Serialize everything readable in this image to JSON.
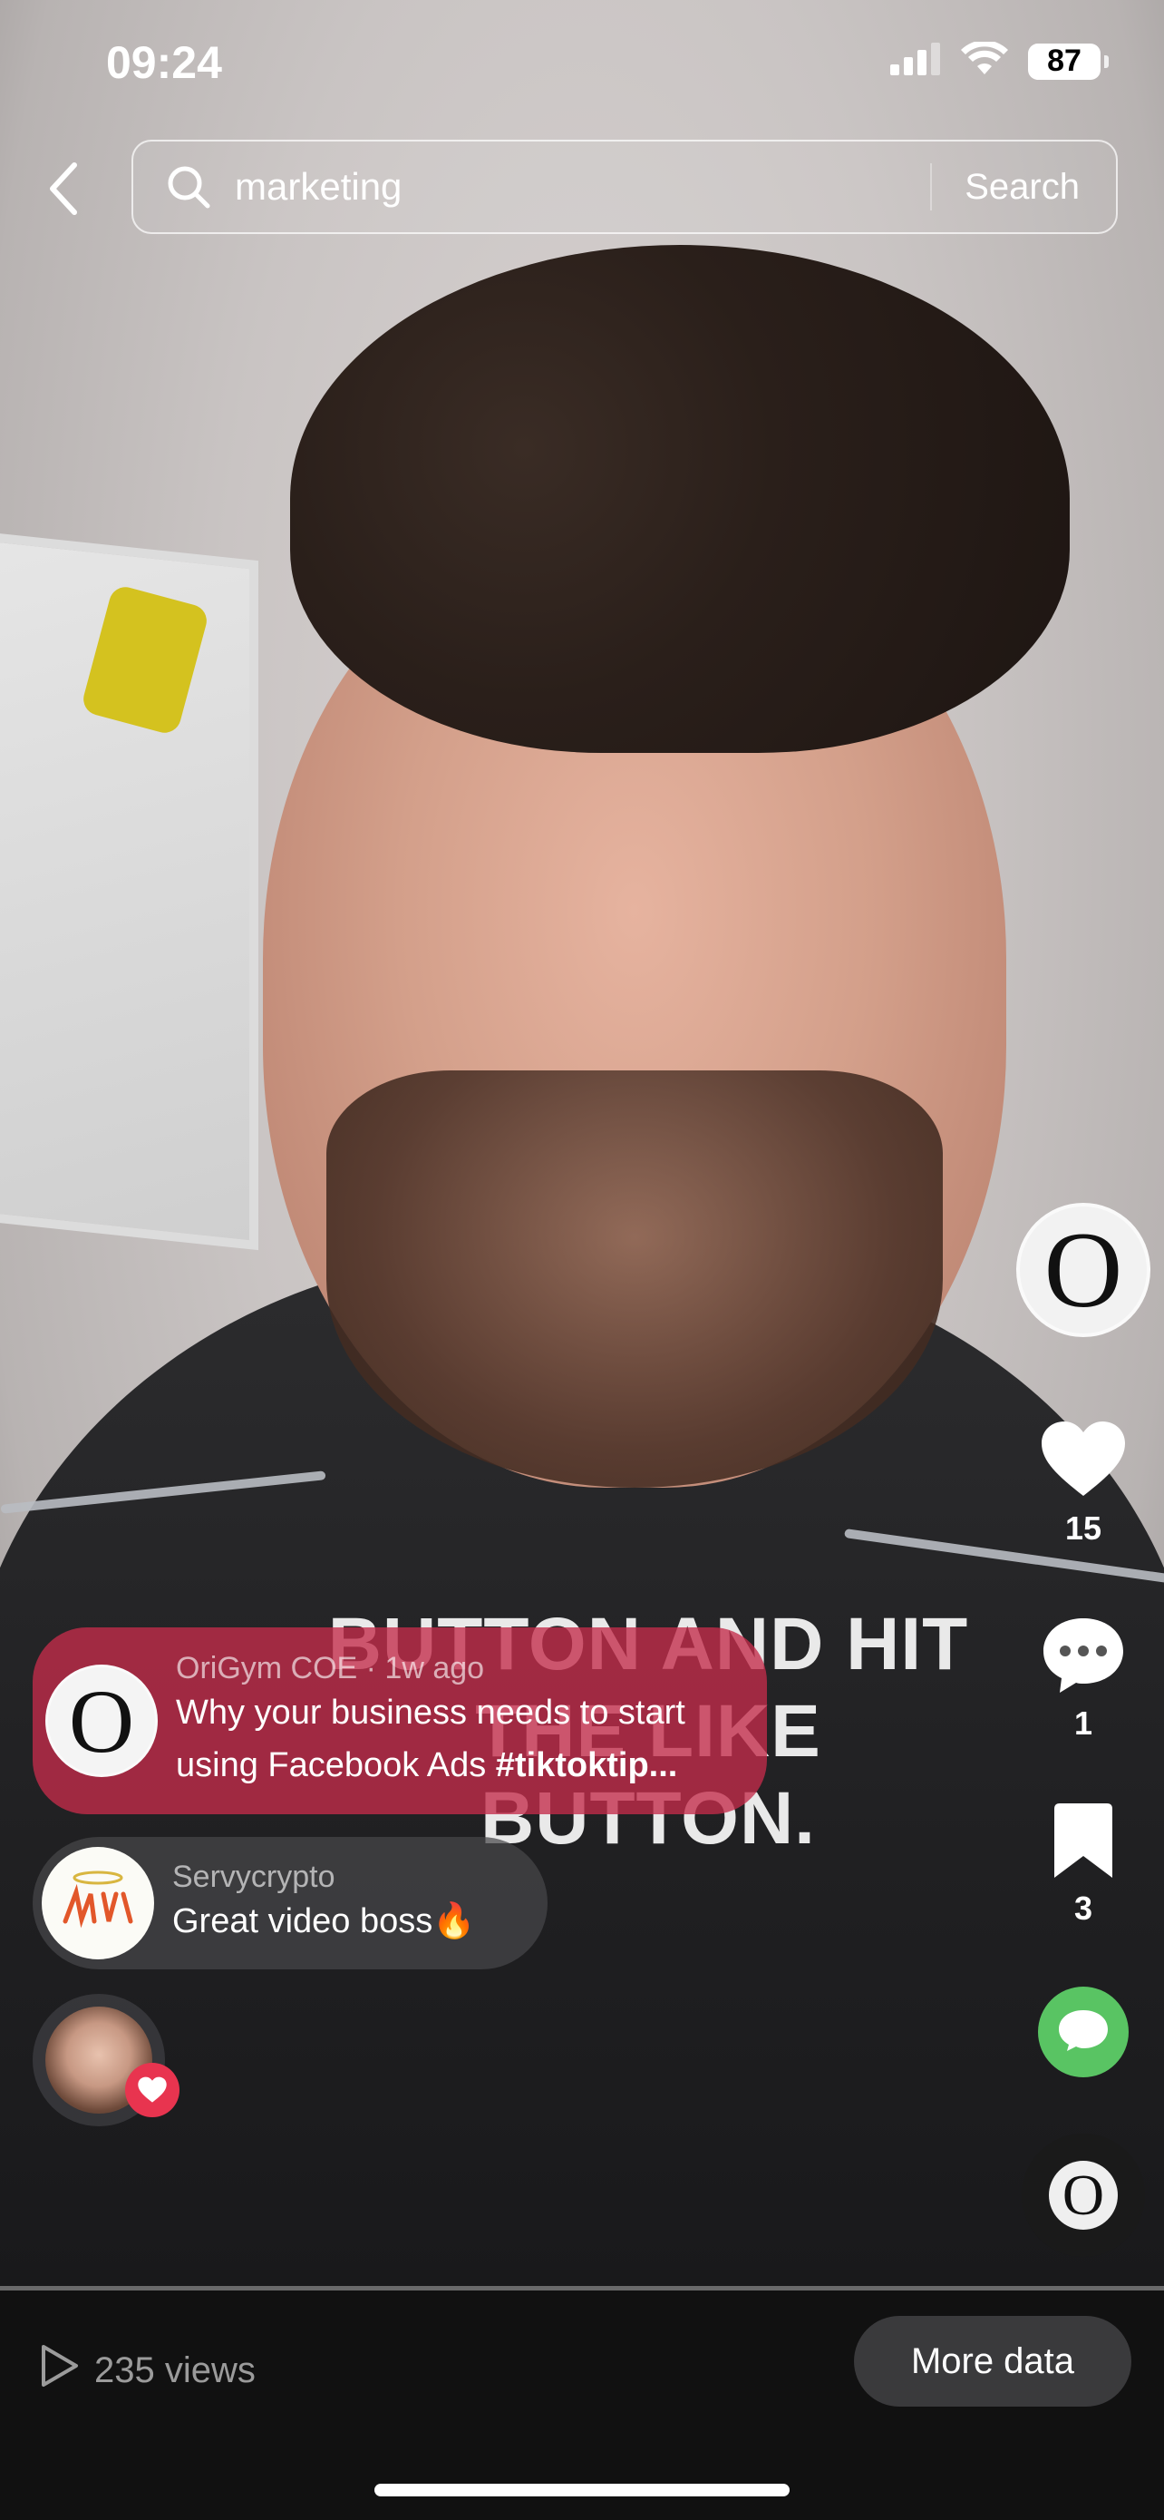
{
  "status_bar": {
    "time": "09:24",
    "battery": "87"
  },
  "search": {
    "query": "marketing",
    "button_label": "Search"
  },
  "video": {
    "caption_line1": "BUTTON AND HIT",
    "caption_line2": "THE LIKE BUTTON."
  },
  "rail": {
    "creator_avatar_letter": "O",
    "likes": "15",
    "comments": "1",
    "saves": "3",
    "music_letter": "O"
  },
  "pinned_comment": {
    "author_meta": "OriGym COE · 1w ago",
    "text_line1": "Why your business needs to start",
    "text_line2": "using Facebook Ads ",
    "hashtag": "#tiktoktip...",
    "avatar_letter": "O"
  },
  "comment": {
    "author": "Servycrypto",
    "text": "Great video boss🔥"
  },
  "footer": {
    "views": "235 views",
    "more_data_label": "More data"
  },
  "colors": {
    "pinned_bubble": "#c42c4a",
    "share_green": "#59c463",
    "heart_badge": "#e8344f"
  },
  "icons": [
    "back-icon",
    "search-icon",
    "heart-icon",
    "comment-icon",
    "bookmark-icon",
    "share-icon",
    "play-icon",
    "signal-icon",
    "wifi-icon"
  ]
}
